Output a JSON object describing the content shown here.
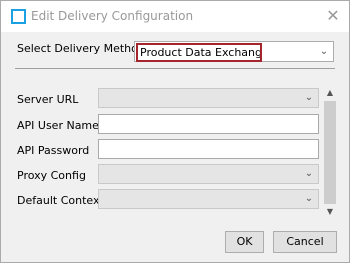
{
  "window": {
    "title": "Edit Delivery Configuration"
  },
  "delivery": {
    "label": "Select Delivery Method",
    "selected": "Product Data Exchange"
  },
  "fields": {
    "server_url": "Server URL",
    "api_user_name": "API User Name",
    "api_password": "API Password",
    "proxy_config": "Proxy Config",
    "default_context": "Default Context"
  },
  "buttons": {
    "ok": "OK",
    "cancel": "Cancel"
  },
  "icons": {
    "close": "close-icon",
    "dropdown": "chevron-down-icon",
    "scroll_up": "scroll-up-arrow-icon",
    "scroll_down": "scroll-down-arrow-icon"
  },
  "colors": {
    "highlight_border": "#a4262c",
    "title_icon": "#1ba1e2"
  }
}
